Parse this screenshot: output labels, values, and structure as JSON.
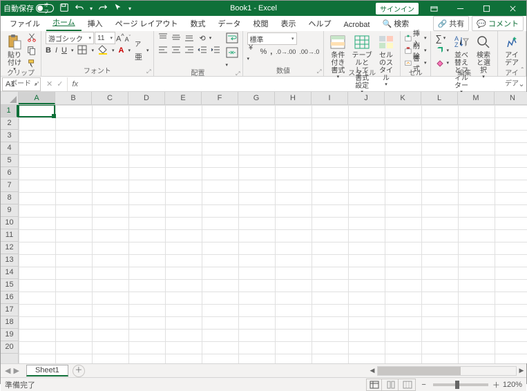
{
  "titlebar": {
    "autosave": "自動保存",
    "autosave_off": "オフ",
    "title": "Book1  -  Excel",
    "signin": "サインイン"
  },
  "menu": {
    "file": "ファイル",
    "home": "ホーム",
    "insert": "挿入",
    "pagelayout": "ページ レイアウト",
    "formulas": "数式",
    "data": "データ",
    "review": "校閲",
    "view": "表示",
    "help": "ヘルプ",
    "acrobat": "Acrobat",
    "search": "検索",
    "share": "共有",
    "comment": "コメント"
  },
  "ribbon": {
    "clipboard": {
      "label": "クリップボード",
      "paste": "貼り付け"
    },
    "font": {
      "label": "フォント",
      "name": "游ゴシック",
      "size": "11"
    },
    "align": {
      "label": "配置"
    },
    "number": {
      "label": "数値",
      "format": "標準"
    },
    "styles": {
      "label": "スタイル",
      "cond": "条件付き書式",
      "table": "テーブルとして書式設定",
      "cell": "セルのスタイル"
    },
    "cells": {
      "label": "セル",
      "insert": "挿入",
      "delete": "削除",
      "format": "書式"
    },
    "editing": {
      "label": "編集",
      "sort": "並べ替えとフィルター",
      "find": "検索と選択"
    },
    "idea": {
      "label": "アイデア",
      "btn": "アイデア"
    }
  },
  "fx": {
    "name": "A1"
  },
  "grid": {
    "cols": [
      "A",
      "B",
      "C",
      "D",
      "E",
      "F",
      "G",
      "H",
      "I",
      "J",
      "K",
      "L",
      "M",
      "N"
    ],
    "rows": [
      "1",
      "2",
      "3",
      "4",
      "5",
      "6",
      "7",
      "8",
      "9",
      "10",
      "11",
      "12",
      "13",
      "14",
      "15",
      "16",
      "17",
      "18",
      "19",
      "20"
    ],
    "active": "A1"
  },
  "tabs": {
    "sheet": "Sheet1"
  },
  "status": {
    "ready": "準備完了",
    "zoom": "120%"
  }
}
